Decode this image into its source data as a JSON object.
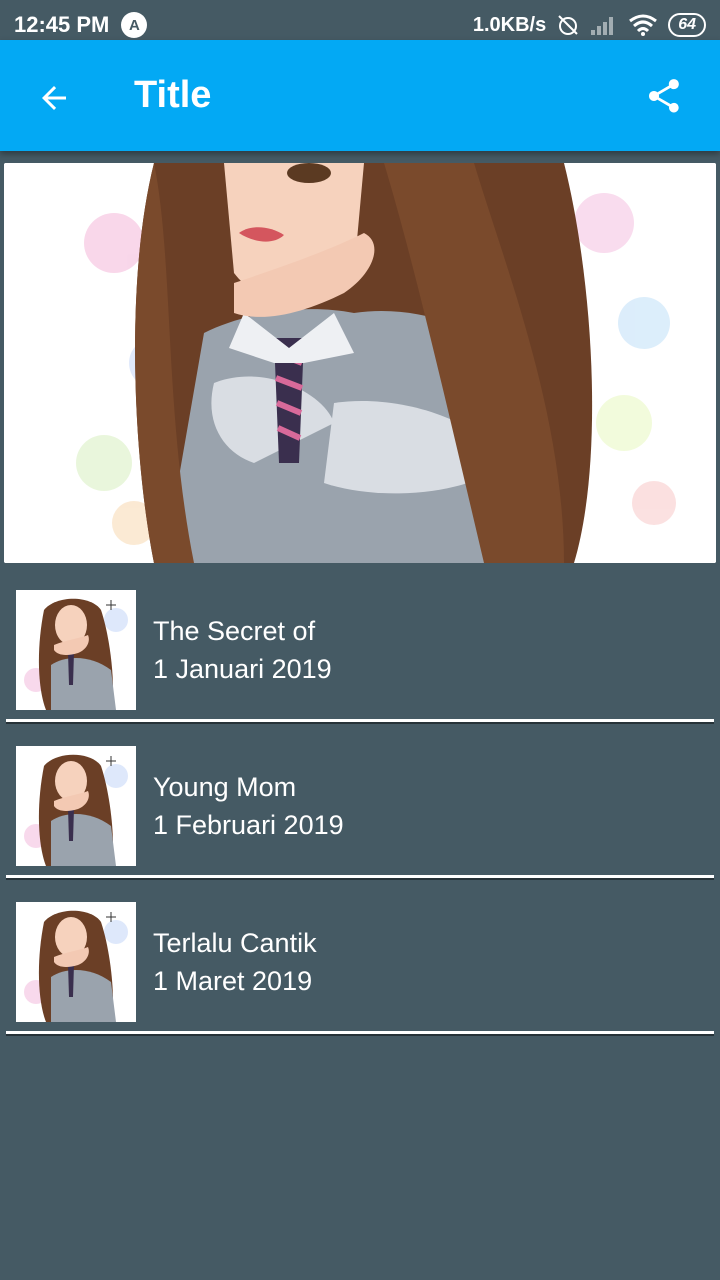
{
  "status_bar": {
    "time": "12:45 PM",
    "app_badge": "A",
    "network_speed": "1.0KB/s",
    "battery": "64"
  },
  "toolbar": {
    "title": "Title",
    "back_icon": "arrow-left-icon",
    "share_icon": "share-icon",
    "background_color": "#03a9f4"
  },
  "hero": {
    "icon": "anime-girl-illustration"
  },
  "items": [
    {
      "title": "The Secret of",
      "date": "1 Januari 2019"
    },
    {
      "title": "Young Mom",
      "date": "1 Februari 2019"
    },
    {
      "title": "Terlalu Cantik",
      "date": "1 Maret 2019"
    }
  ],
  "colors": {
    "background": "#455a64",
    "accent": "#03a9f4"
  }
}
